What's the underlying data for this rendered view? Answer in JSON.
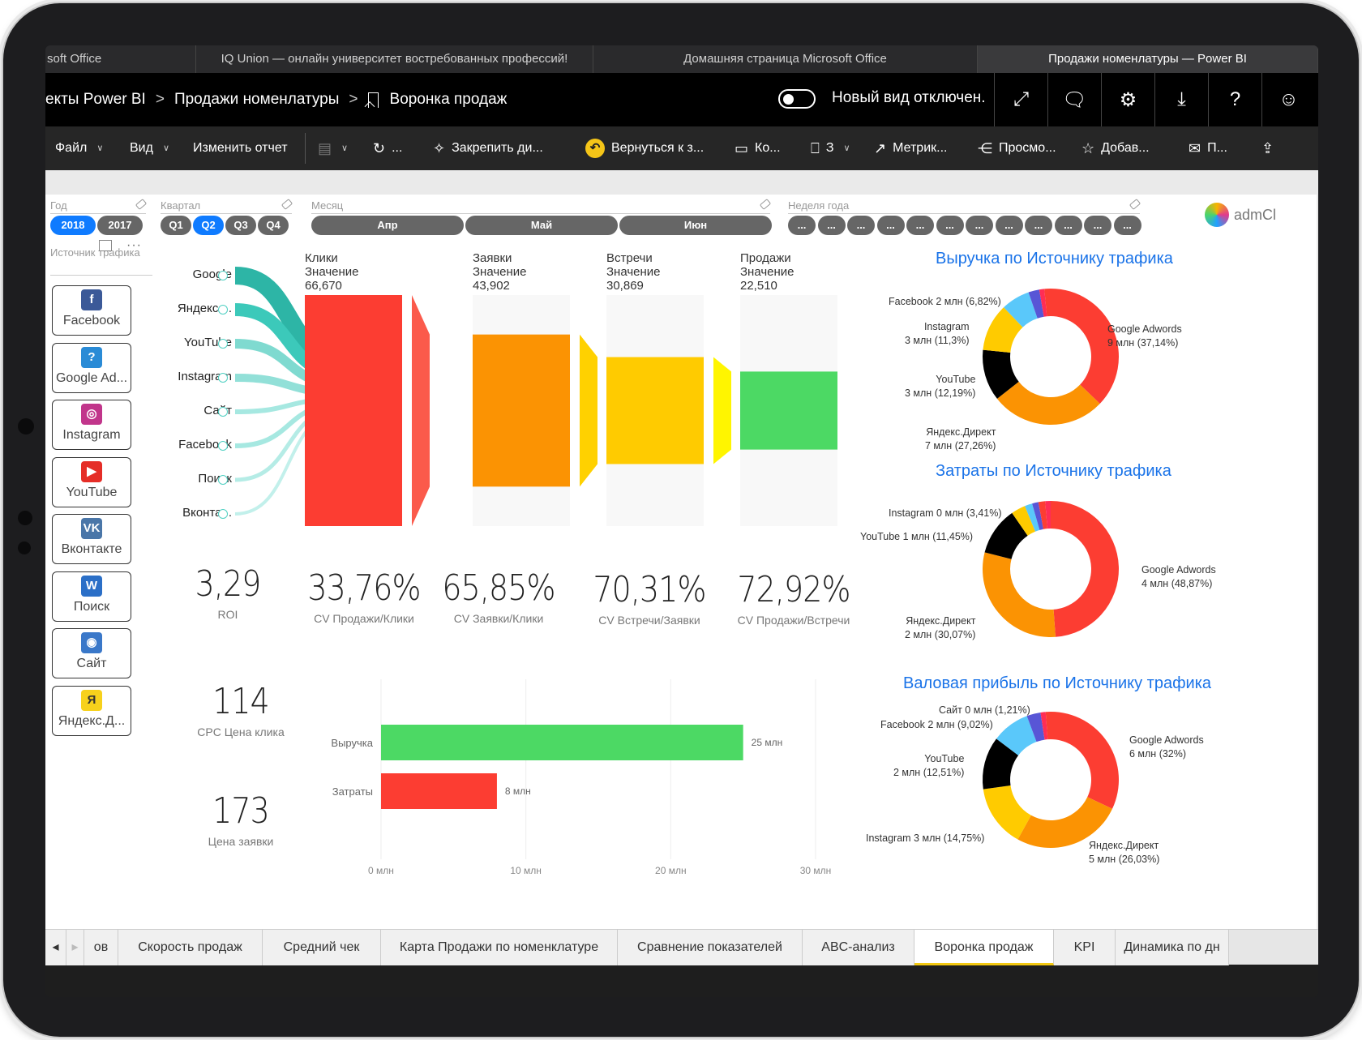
{
  "browser_tabs": [
    {
      "label": "soft Office",
      "active": false
    },
    {
      "label": "IQ Union — онлайн университет востребованных профессий!",
      "active": false
    },
    {
      "label": "Домашняя страница Microsoft Office",
      "active": false
    },
    {
      "label": "Продажи номенлатуры — Power BI",
      "active": true
    }
  ],
  "header": {
    "breadcrumb": [
      "екты Power BI",
      "Продажи номенлатуры",
      "Воронка продаж"
    ],
    "new_view_label": "Новый вид отключен.",
    "icons": [
      "expand-icon",
      "comment-icon",
      "settings-icon",
      "download-icon",
      "help-icon",
      "feedback-smiley-icon"
    ],
    "icon_glyphs": [
      "⤢",
      "🗨",
      "⚙",
      "⤓",
      "?",
      "☺"
    ]
  },
  "toolbar": {
    "file": "Файл",
    "view": "Вид",
    "edit": "Изменить отчет",
    "more": "...",
    "pin": "Закрепить ди...",
    "revert": "Вернуться к з...",
    "comments": "Ко...",
    "bookmarks": "З",
    "metrics": "Метрик...",
    "lineage": "Просмо...",
    "favorite": "Добав...",
    "subscribe": "П..."
  },
  "filters": {
    "year": {
      "label": "Год",
      "options": [
        "2018",
        "2017"
      ],
      "selected": "2018"
    },
    "quarter": {
      "label": "Квартал",
      "options": [
        "Q1",
        "Q2",
        "Q3",
        "Q4"
      ],
      "selected": "Q2"
    },
    "month": {
      "label": "Месяц",
      "options": [
        "Апр",
        "Май",
        "Июн"
      ]
    },
    "week": {
      "label": "Неделя года",
      "options": [
        "...",
        "...",
        "...",
        "...",
        "...",
        "...",
        "...",
        "...",
        "...",
        "...",
        "...",
        "..."
      ]
    },
    "logo_text": "admCl"
  },
  "source_slicer": {
    "label": "Источник трафика",
    "items": [
      {
        "label": "Facebook",
        "icon": "facebook-icon",
        "glyph": "f",
        "color": "#3b5998"
      },
      {
        "label": "Google Ad...",
        "icon": "google-ads-icon",
        "glyph": "?",
        "color": "#2a8bd6"
      },
      {
        "label": "Instagram",
        "icon": "instagram-icon",
        "glyph": "◎",
        "color": "#c1358b"
      },
      {
        "label": "YouTube",
        "icon": "youtube-icon",
        "glyph": "▶",
        "color": "#e52d27"
      },
      {
        "label": "Вконтакте",
        "icon": "vk-icon",
        "glyph": "VK",
        "color": "#4a76a8"
      },
      {
        "label": "Поиск",
        "icon": "www-search-icon",
        "glyph": "W",
        "color": "#2b6fc7"
      },
      {
        "label": "Сайт",
        "icon": "globe-icon",
        "glyph": "◉",
        "color": "#3a78c9"
      },
      {
        "label": "Яндекс.Д...",
        "icon": "yandex-direct-icon",
        "glyph": "Я",
        "color": "#f7d11c"
      }
    ]
  },
  "sankey": {
    "sources": [
      "Google",
      "Яндекс....",
      "YouTube",
      "Instagram",
      "Сайт",
      "Facebook",
      "Поиск",
      "Вконта..."
    ]
  },
  "funnel": {
    "stages": [
      {
        "name": "Клики",
        "sub": "Значение",
        "value": "66,670",
        "raw": 66670,
        "color": "#fc3d32",
        "conn": "#fb5a4b"
      },
      {
        "name": "Заявки",
        "sub": "Значение",
        "value": "43,902",
        "raw": 43902,
        "color": "#fb9303",
        "conn": "#ffd100"
      },
      {
        "name": "Встречи",
        "sub": "Значение",
        "value": "30,869",
        "raw": 30869,
        "color": "#ffcb00",
        "conn": "#fff500"
      },
      {
        "name": "Продажи",
        "sub": "Значение",
        "value": "22,510",
        "raw": 22510,
        "color": "#4cd964",
        "conn": null
      }
    ]
  },
  "kpis": [
    {
      "value": "3,29",
      "label": "ROI"
    },
    {
      "value": "33,76%",
      "label": "CV Продажи/Клики"
    },
    {
      "value": "65,85%",
      "label": "CV Заявки/Клики"
    },
    {
      "value": "70,31%",
      "label": "CV Встречи/Заявки"
    },
    {
      "value": "72,92%",
      "label": "CV Продажи/Встречи"
    },
    {
      "value": "114",
      "label": "CPC Цена клика"
    },
    {
      "value": "173",
      "label": "Цена заявки"
    }
  ],
  "chart_data": [
    {
      "type": "bar",
      "orientation": "horizontal",
      "categories": [
        "Выручка",
        "Затраты"
      ],
      "values": [
        25,
        8
      ],
      "data_labels": [
        "25 млн",
        "8 млн"
      ],
      "colors": [
        "#4cd964",
        "#fc3d32"
      ],
      "xticks": [
        "0 млн",
        "10 млн",
        "20 млн",
        "30 млн"
      ],
      "xlim": [
        0,
        30
      ],
      "grid": true
    },
    {
      "type": "pie",
      "donut": true,
      "title": "Выручка по Источнику трафика",
      "slices": [
        {
          "name": "Google Adwords",
          "value": 37.14,
          "label": "Google Adwords\n9 млн (37,14%)",
          "color": "#fc3d32"
        },
        {
          "name": "Яндекс.Директ",
          "value": 27.26,
          "label": "Яндекс.Директ\n7 млн (27,26%)",
          "color": "#fb9303"
        },
        {
          "name": "YouTube",
          "value": 12.19,
          "label": "YouTube\n3 млн (12,19%)",
          "color": "#000000"
        },
        {
          "name": "Instagram",
          "value": 11.3,
          "label": "Instagram\n3 млн (11,3%)",
          "color": "#ffcb00"
        },
        {
          "name": "Facebook",
          "value": 6.82,
          "label": "Facebook 2 млн (6,82%)",
          "color": "#5ac8fa"
        },
        {
          "name": "Поиск",
          "value": 2.6,
          "label": "",
          "color": "#5856d6"
        },
        {
          "name": "Сайт",
          "value": 1.2,
          "label": "",
          "color": "#ff2d55"
        },
        {
          "name": "Вконтакте",
          "value": 1.49,
          "label": "",
          "color": "#fc3d32"
        }
      ]
    },
    {
      "type": "pie",
      "donut": true,
      "title": "Затраты по Источнику трафика",
      "slices": [
        {
          "name": "Google Adwords",
          "value": 48.87,
          "label": "Google Adwords\n4 млн (48,87%)",
          "color": "#fc3d32"
        },
        {
          "name": "Яндекс.Директ",
          "value": 30.07,
          "label": "Яндекс.Директ\n2 млн (30,07%)",
          "color": "#fb9303"
        },
        {
          "name": "YouTube",
          "value": 11.45,
          "label": "YouTube 1 млн (11,45%)",
          "color": "#000000"
        },
        {
          "name": "Instagram",
          "value": 3.41,
          "label": "Instagram 0 млн (3,41%)",
          "color": "#ffcb00"
        },
        {
          "name": "Facebook",
          "value": 1.8,
          "label": "",
          "color": "#5ac8fa"
        },
        {
          "name": "Поиск",
          "value": 1.5,
          "label": "",
          "color": "#5856d6"
        },
        {
          "name": "Вконтакте",
          "value": 1.6,
          "label": "",
          "color": "#fc3d32"
        },
        {
          "name": "Сайт",
          "value": 1.3,
          "label": "",
          "color": "#ff2d55"
        }
      ]
    },
    {
      "type": "pie",
      "donut": true,
      "title": "Валовая прибыль по Источнику трафика",
      "slices": [
        {
          "name": "Google Adwords",
          "value": 32.0,
          "label": "Google Adwords\n6 млн (32%)",
          "color": "#fc3d32"
        },
        {
          "name": "Яндекс.Директ",
          "value": 26.03,
          "label": "Яндекс.Директ\n5 млн (26,03%)",
          "color": "#fb9303"
        },
        {
          "name": "Instagram",
          "value": 14.75,
          "label": "Instagram 3 млн (14,75%)",
          "color": "#ffcb00"
        },
        {
          "name": "YouTube",
          "value": 12.51,
          "label": "YouTube\n2 млн (12,51%)",
          "color": "#000000"
        },
        {
          "name": "Facebook",
          "value": 9.02,
          "label": "Facebook 2 млн (9,02%)",
          "color": "#5ac8fa"
        },
        {
          "name": "Поиск",
          "value": 3.3,
          "label": "",
          "color": "#5856d6"
        },
        {
          "name": "Сайт",
          "value": 1.21,
          "label": "Сайт 0 млн (1,21%)",
          "color": "#ff2d55"
        },
        {
          "name": "Вконтакте",
          "value": 1.18,
          "label": "",
          "color": "#fc3d32"
        }
      ]
    }
  ],
  "page_tabs": [
    {
      "label": "ов",
      "active": false
    },
    {
      "label": "Скорость продаж",
      "active": false
    },
    {
      "label": "Средний чек",
      "active": false
    },
    {
      "label": "Карта Продажи по номенклатуре",
      "active": false
    },
    {
      "label": "Сравнение показателей",
      "active": false
    },
    {
      "label": "ABC-анализ",
      "active": false
    },
    {
      "label": "Воронка продаж",
      "active": true
    },
    {
      "label": "KPI",
      "active": false
    },
    {
      "label": "Динамика по дн",
      "active": false
    }
  ]
}
